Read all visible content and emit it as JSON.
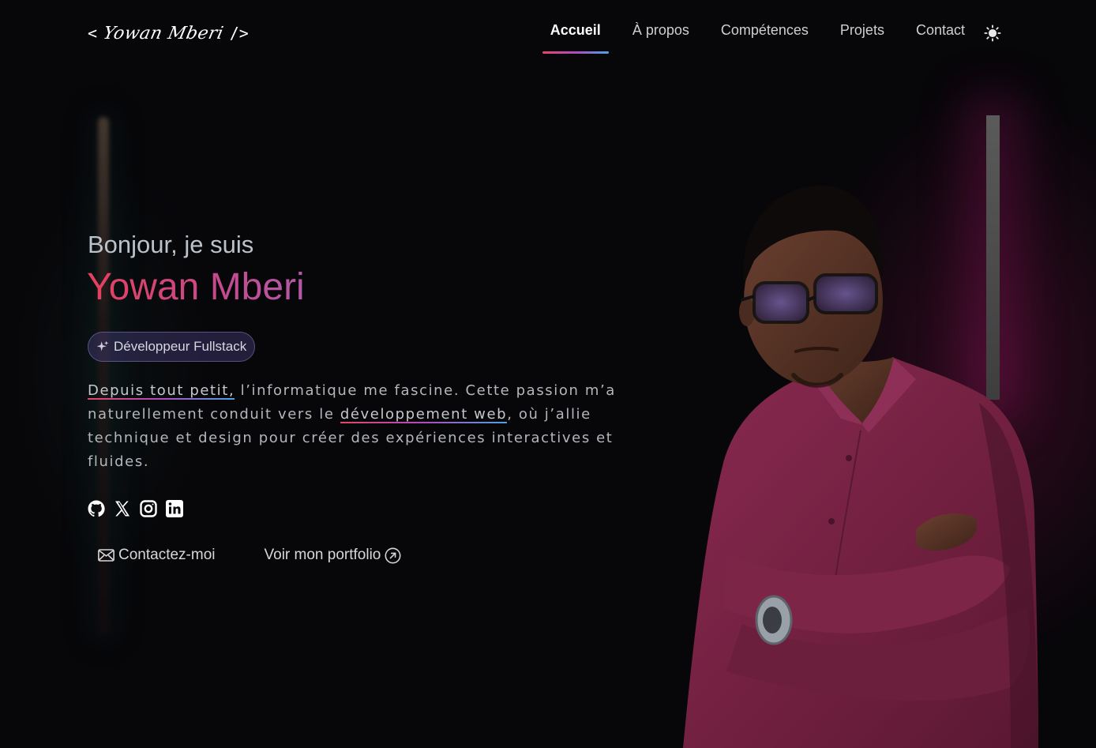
{
  "header": {
    "logo": {
      "open": "<",
      "signature": "Yowan Mberi",
      "close": "/>"
    },
    "nav": [
      {
        "label": "Accueil",
        "active": true
      },
      {
        "label": "À propos",
        "active": false
      },
      {
        "label": "Compétences",
        "active": false
      },
      {
        "label": "Projets",
        "active": false
      },
      {
        "label": "Contact",
        "active": false
      }
    ],
    "theme_toggle_icon": "sun-icon"
  },
  "hero": {
    "greeting": "Bonjour, je suis",
    "name": "Yowan Mberi",
    "role_badge": {
      "icon": "sparkle-icon",
      "label": "Développeur Fullstack"
    },
    "bio": {
      "highlight_1": "Depuis tout petit,",
      "text_1": " l’informatique me fascine. Cette passion m’a naturellement conduit vers le ",
      "highlight_2": "développement web",
      "text_2": ", où j’allie technique et design pour créer des expériences interactives et fluides."
    },
    "socials": [
      "github-icon",
      "x-icon",
      "instagram-icon",
      "linkedin-icon"
    ],
    "buttons": {
      "contact": {
        "icon": "mail-icon",
        "label": "Contactez-moi"
      },
      "portfolio": {
        "icon": "arrow-up-right-icon",
        "label": "Voir mon portfolio"
      }
    }
  },
  "colors": {
    "background": "#070609",
    "accent_gradient": [
      "#e2466a",
      "#b04ac0",
      "#4aa3e8"
    ],
    "name_gradient": [
      "#e73f5e",
      "#b25aa8"
    ],
    "shirt": "#7a2345"
  }
}
